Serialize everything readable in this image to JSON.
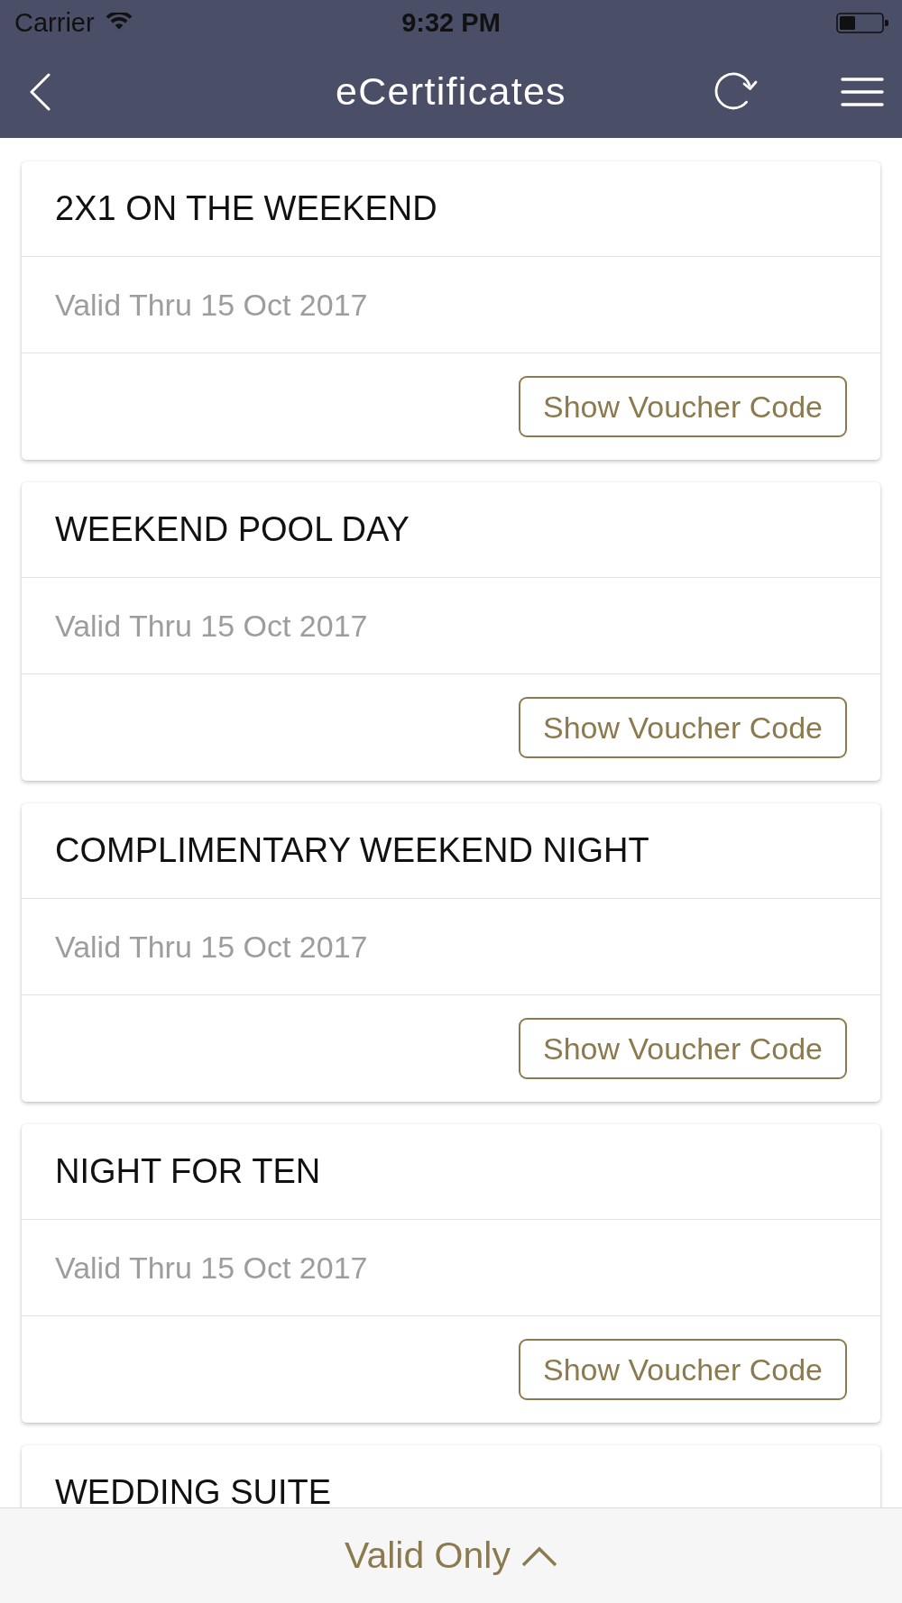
{
  "status_bar": {
    "carrier": "Carrier",
    "time": "9:32 PM"
  },
  "nav_bar": {
    "title": "eCertificates"
  },
  "certificates": [
    {
      "title": "2X1 ON THE WEEKEND",
      "validity": "Valid Thru 15 Oct 2017",
      "button": "Show Voucher Code"
    },
    {
      "title": "WEEKEND POOL DAY",
      "validity": "Valid Thru 15 Oct 2017",
      "button": "Show Voucher Code"
    },
    {
      "title": "COMPLIMENTARY WEEKEND NIGHT",
      "validity": "Valid Thru 15 Oct 2017",
      "button": "Show Voucher Code"
    },
    {
      "title": "NIGHT FOR TEN",
      "validity": "Valid Thru 15 Oct 2017",
      "button": "Show Voucher Code"
    },
    {
      "title": "WEDDING SUITE"
    }
  ],
  "filter_bar": {
    "label": "Valid Only"
  }
}
